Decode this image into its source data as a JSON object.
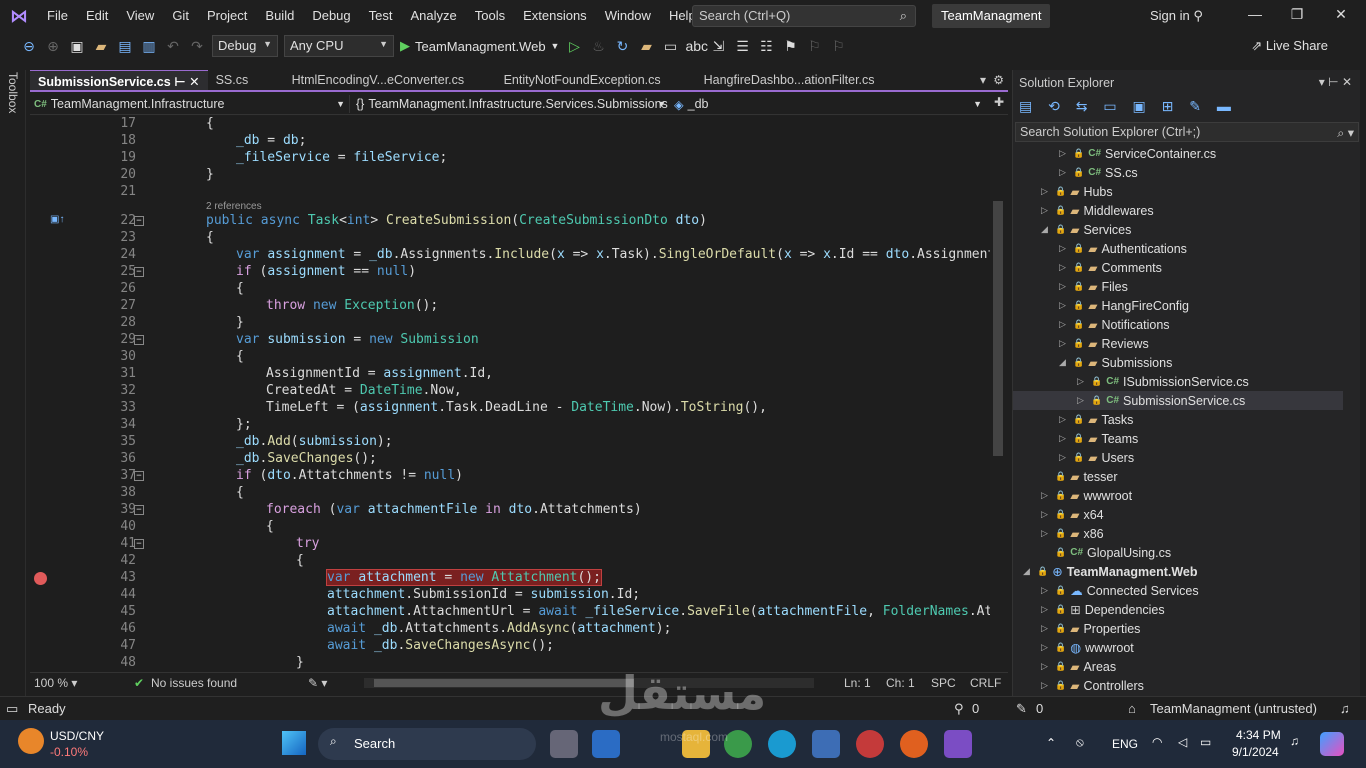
{
  "menu": {
    "items": [
      "File",
      "Edit",
      "View",
      "Git",
      "Project",
      "Build",
      "Debug",
      "Test",
      "Analyze",
      "Tools",
      "Extensions",
      "Window",
      "Help"
    ],
    "search_placeholder": "Search (Ctrl+Q)",
    "solution_name": "TeamManagment",
    "sign_in": "Sign in"
  },
  "toolbar": {
    "config": "Debug",
    "platform": "Any CPU",
    "run_target": "TeamManagment.Web",
    "live_share": "Live Share"
  },
  "toolbox": {
    "label": "Toolbox"
  },
  "tabs": [
    "SubmissionService.cs",
    "SS.cs",
    "HtmlEncodingV...eConverter.cs",
    "EntityNotFoundException.cs",
    "HangfireDashbo...ationFilter.cs"
  ],
  "nav": {
    "project": "TeamManagment.Infrastructure",
    "class": "TeamManagment.Infrastructure.Services.Submissions",
    "member": "_db"
  },
  "code": {
    "references": "2 references",
    "line_numbers": [
      "17",
      "18",
      "19",
      "20",
      "21",
      "22",
      "23",
      "24",
      "25",
      "26",
      "27",
      "28",
      "29",
      "30",
      "31",
      "32",
      "33",
      "34",
      "35",
      "36",
      "37",
      "38",
      "39",
      "40",
      "41",
      "42",
      "43",
      "44",
      "45",
      "46",
      "47",
      "48"
    ]
  },
  "editor_status": {
    "zoom": "100 %",
    "issues": "No issues found",
    "ln": "Ln: 1",
    "ch": "Ch: 1",
    "spc": "SPC",
    "crlf": "CRLF"
  },
  "solution_explorer": {
    "title": "Solution Explorer",
    "search": "Search Solution Explorer (Ctrl+;)",
    "items": [
      "ServiceContainer.cs",
      "SS.cs",
      "Hubs",
      "Middlewares",
      "Services",
      "Authentications",
      "Comments",
      "Files",
      "HangFireConfig",
      "Notifications",
      "Reviews",
      "Submissions",
      "ISubmissionService.cs",
      "SubmissionService.cs",
      "Tasks",
      "Teams",
      "Users",
      "tesser",
      "wwwroot",
      "x64",
      "x86",
      "GlopalUsing.cs",
      "TeamManagment.Web",
      "Connected Services",
      "Dependencies",
      "Properties",
      "wwwroot",
      "Areas",
      "Controllers"
    ]
  },
  "status": {
    "ready": "Ready",
    "errors": "0",
    "warnings": "0",
    "repo": "TeamManagment (untrusted)"
  },
  "taskbar": {
    "ticker": "USD/CNY",
    "change": "-0.10%",
    "search": "Search",
    "lang": "ENG",
    "time": "4:34 PM",
    "date": "9/1/2024"
  },
  "watermark": {
    "text": "مستقل",
    "sub": "mostaql.com"
  }
}
